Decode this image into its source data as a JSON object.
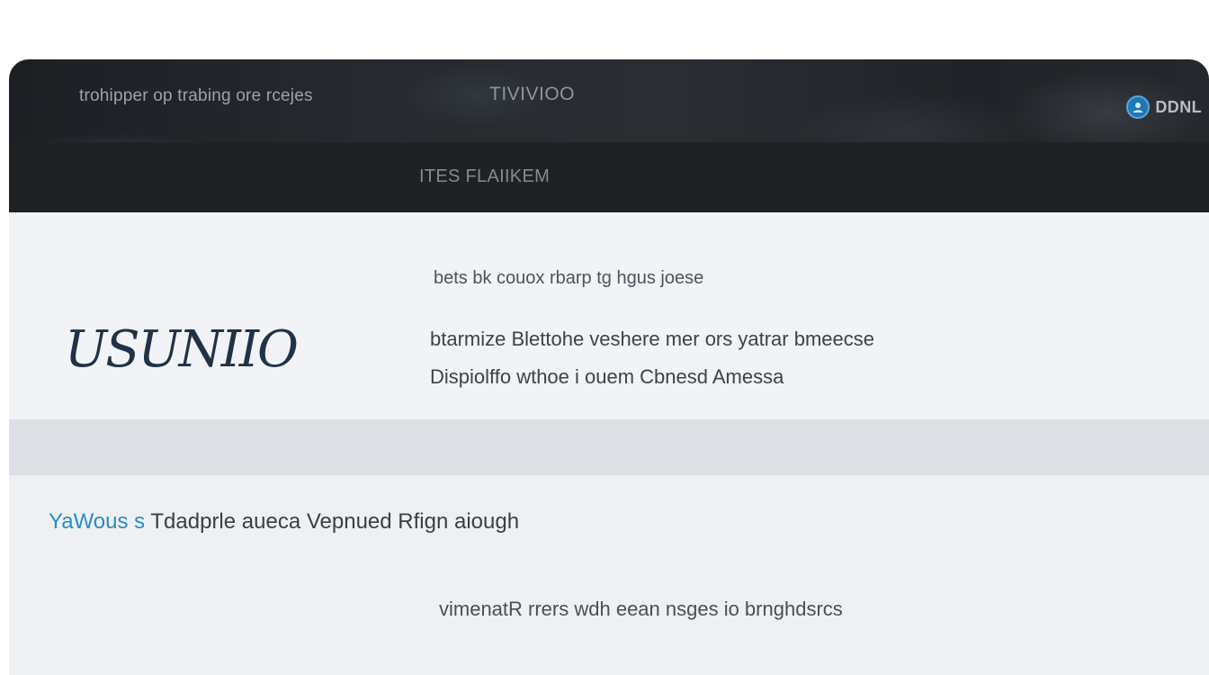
{
  "header": {
    "tagline": "trohipper op trabing ore rcejes",
    "brand": "TIVIVIOO",
    "account_icon": "user-avatar-icon",
    "account_label": "DDNL",
    "nav_label": "ITES FLAIIKEM"
  },
  "hero": {
    "logo_text": "USUNIIO",
    "intro": "bets bk couox rbarp tg hgus joese",
    "line1": "btarmize Blettohe veshere mer ors yatrar bmeecse",
    "line2": "Dispiolffo wthoe i ouem Cbnesd Amessa"
  },
  "lower": {
    "callout_accent": "YaWous s",
    "callout_rest": " Tdadprle aueca Vepnued Rfign aiough",
    "footer_note": "vimenatR rrers wdh eean nsges io brnghdsrcs"
  },
  "colors": {
    "header_bg": "#24282c",
    "nav_bg": "#1f2225",
    "hero_bg": "#f1f3f6",
    "divider_bg": "#dcdfe3",
    "accent": "#2a8cc4",
    "logo": "#203248"
  }
}
